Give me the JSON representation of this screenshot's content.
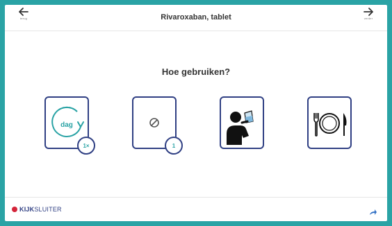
{
  "header": {
    "title": "Rivaroxaban, tablet",
    "back_label": "terug",
    "forward_label": "verder"
  },
  "main": {
    "question": "Hoe gebruiken?",
    "icons": [
      {
        "name": "frequency",
        "inner_text": "dag",
        "badge": "1×"
      },
      {
        "name": "tablet",
        "badge": "1"
      },
      {
        "name": "drink-water"
      },
      {
        "name": "meal"
      }
    ]
  },
  "footer": {
    "brand_bold": "KIJK",
    "brand_light": "SLUITER"
  },
  "colors": {
    "background": "#2aa3a5",
    "accent": "#2aa3a5",
    "frame": "#2f3f83",
    "brand_red": "#d4253a"
  }
}
